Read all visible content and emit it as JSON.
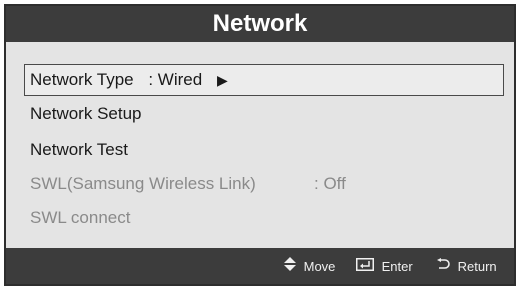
{
  "header": {
    "title": "Network"
  },
  "menu": {
    "items": [
      {
        "label": "Network Type",
        "value": ": Wired",
        "arrow": "▶"
      },
      {
        "label": "Network Setup"
      },
      {
        "label": "Network Test"
      },
      {
        "label": "SWL(Samsung Wireless Link)",
        "value": ": Off"
      },
      {
        "label": "SWL connect"
      }
    ]
  },
  "footer": {
    "move_label": "Move",
    "enter_label": "Enter",
    "return_label": "Return"
  },
  "colors": {
    "title_bar": "#3c3c3c",
    "menu_background": "#e4e4e4",
    "disabled_text": "#8a8a8a"
  }
}
